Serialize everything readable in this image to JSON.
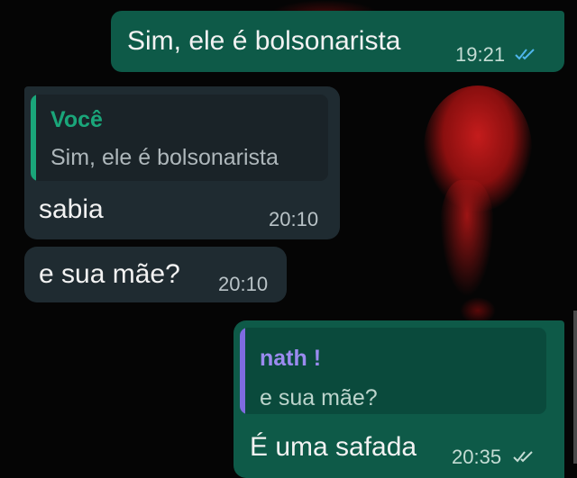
{
  "messages": [
    {
      "direction": "outgoing",
      "text": "Sim, ele é bolsonarista",
      "time": "19:21",
      "status": "read"
    },
    {
      "direction": "incoming",
      "quote": {
        "author": "Você",
        "text": "Sim, ele é bolsonarista"
      },
      "text": "sabia",
      "time": "20:10"
    },
    {
      "direction": "incoming",
      "text": "e sua mãe?",
      "time": "20:10"
    },
    {
      "direction": "outgoing",
      "quote": {
        "author": "nath !",
        "text": "e sua mãe?"
      },
      "text": "É uma safada",
      "time": "20:35",
      "status": "sent"
    }
  ],
  "colors": {
    "outgoing_bubble": "#0e5a48",
    "incoming_bubble": "#1f2b31",
    "quote_bar_you": "#1aa67a",
    "quote_bar_other": "#7f6be0",
    "read_ticks": "#4fb6ec"
  }
}
